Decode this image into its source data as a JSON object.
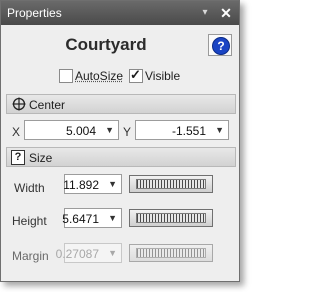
{
  "window": {
    "title": "Properties"
  },
  "header": {
    "title": "Courtyard",
    "help_label": "?"
  },
  "options": {
    "autosize": {
      "label": "AutoSize",
      "checked": false
    },
    "visible": {
      "label": "Visible",
      "checked": true
    }
  },
  "center": {
    "section_label": "Center",
    "x_label": "X",
    "x_value": "5.004",
    "y_label": "Y",
    "y_value": "-1.551"
  },
  "size": {
    "section_label": "Size",
    "width_label": "Width",
    "width_value": "11.892",
    "height_label": "Height",
    "height_value": "5.6471",
    "margin_label": "Margin",
    "margin_value": "0.27087",
    "margin_enabled": false
  },
  "icons": {
    "pin": "pin-icon",
    "close": "close-icon",
    "help": "help-icon",
    "center": "crosshair-icon",
    "size": "question-box-icon",
    "dropdown": "chevron-down-icon",
    "jog": "jog-wheel-icon"
  },
  "colors": {
    "titlebar": "#555555",
    "help_accent": "#1a44c4",
    "panel_bg": "#eeeeee"
  }
}
